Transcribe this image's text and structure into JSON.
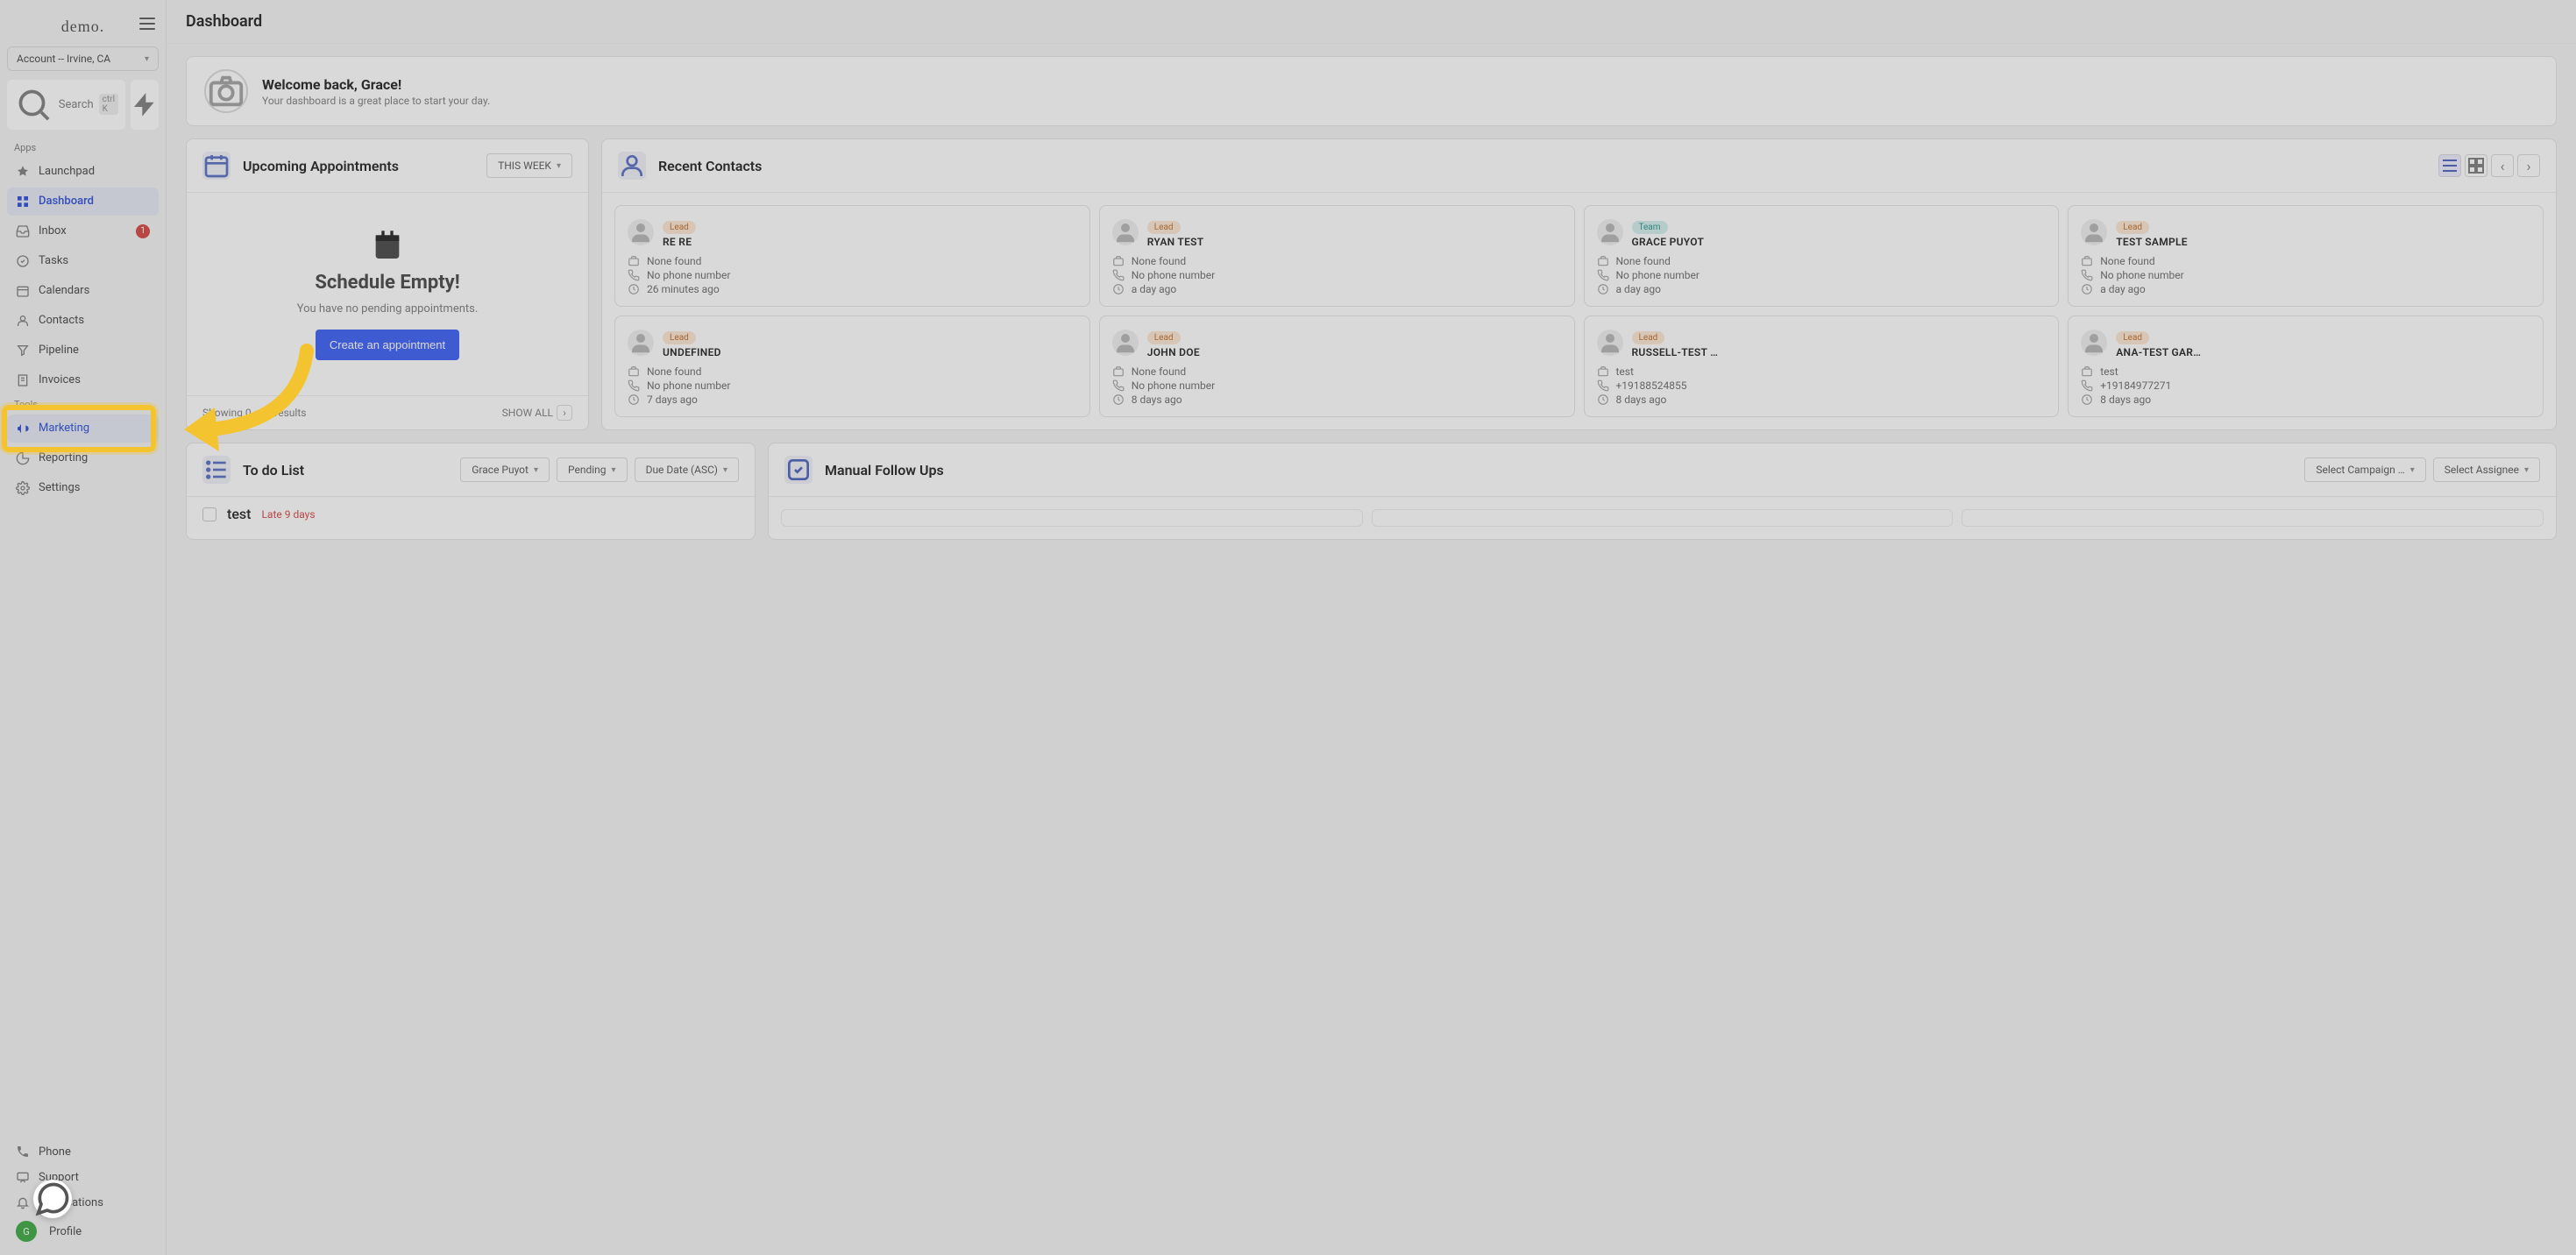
{
  "logo": "demo.",
  "account_selector": "Account -- Irvine, CA",
  "search": {
    "placeholder": "Search",
    "shortcut": "ctrl K"
  },
  "sections": {
    "apps": "Apps",
    "tools": "Tools"
  },
  "nav": {
    "launchpad": "Launchpad",
    "dashboard": "Dashboard",
    "inbox": "Inbox",
    "inbox_badge": "1",
    "tasks": "Tasks",
    "calendars": "Calendars",
    "contacts": "Contacts",
    "pipeline": "Pipeline",
    "invoices": "Invoices",
    "marketing": "Marketing",
    "reporting": "Reporting",
    "settings": "Settings",
    "phone": "Phone",
    "support": "Support",
    "notifications": "Notifications",
    "profile": "Profile",
    "profile_initials": "G"
  },
  "page_title": "Dashboard",
  "welcome": {
    "title": "Welcome back, Grace!",
    "subtitle": "Your dashboard is a great place to start your day."
  },
  "appointments": {
    "title": "Upcoming Appointments",
    "filter": "THIS WEEK",
    "empty_title": "Schedule Empty!",
    "empty_sub": "You have no pending appointments.",
    "cta": "Create an appointment",
    "results": "Showing 0 of 0 results",
    "showall": "SHOW ALL"
  },
  "recent_contacts": {
    "title": "Recent Contacts",
    "items": [
      {
        "tag": "Lead",
        "tag_class": "tag-lead",
        "name": "RE RE",
        "org": "None found",
        "phone": "No phone number",
        "time": "26 minutes ago"
      },
      {
        "tag": "Lead",
        "tag_class": "tag-lead",
        "name": "RYAN TEST",
        "org": "None found",
        "phone": "No phone number",
        "time": "a day ago"
      },
      {
        "tag": "Team",
        "tag_class": "tag-team",
        "name": "GRACE PUYOT",
        "org": "None found",
        "phone": "No phone number",
        "time": "a day ago"
      },
      {
        "tag": "Lead",
        "tag_class": "tag-lead",
        "name": "TEST SAMPLE",
        "org": "None found",
        "phone": "No phone number",
        "time": "a day ago"
      },
      {
        "tag": "Lead",
        "tag_class": "tag-lead",
        "name": "UNDEFINED",
        "org": "None found",
        "phone": "No phone number",
        "time": "7 days ago"
      },
      {
        "tag": "Lead",
        "tag_class": "tag-lead",
        "name": "JOHN DOE",
        "org": "None found",
        "phone": "No phone number",
        "time": "8 days ago"
      },
      {
        "tag": "Lead",
        "tag_class": "tag-lead",
        "name": "RUSSELL-TEST …",
        "org": "test",
        "phone": "+19188524855",
        "time": "8 days ago"
      },
      {
        "tag": "Lead",
        "tag_class": "tag-lead",
        "name": "ANA-TEST GAR…",
        "org": "test",
        "phone": "+19184977271",
        "time": "8 days ago"
      }
    ]
  },
  "todo": {
    "title": "To do List",
    "assignee": "Grace Puyot",
    "status": "Pending",
    "sort": "Due Date (ASC)",
    "item": "test",
    "late": "Late 9 days"
  },
  "followups": {
    "title": "Manual Follow Ups",
    "campaign": "Select Campaign …",
    "assignee": "Select Assignee"
  }
}
